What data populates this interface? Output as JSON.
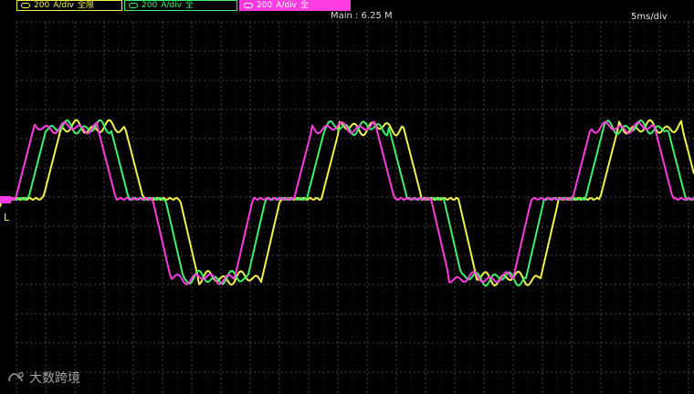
{
  "header": {
    "channels": [
      {
        "label": "200",
        "unit": "A/div",
        "suffix": "全限",
        "color": "#f2f24a"
      },
      {
        "label": "200",
        "unit": "A/div",
        "suffix": "全",
        "color": "#3ef26a"
      },
      {
        "label": "200",
        "unit": "A/div",
        "suffix": "全",
        "color": "#ff3ce0"
      }
    ],
    "main": "Main : 6.25 M",
    "timebase": "5ms/div"
  },
  "left_marker_label": "L",
  "watermark": {
    "text": "大数跨境"
  },
  "colors": {
    "grid": "#4a4a4a",
    "grid_minor": "#2a2a2a",
    "yellow": "#f2f24a",
    "green": "#3ef26a",
    "magenta": "#ff3ce0"
  }
}
